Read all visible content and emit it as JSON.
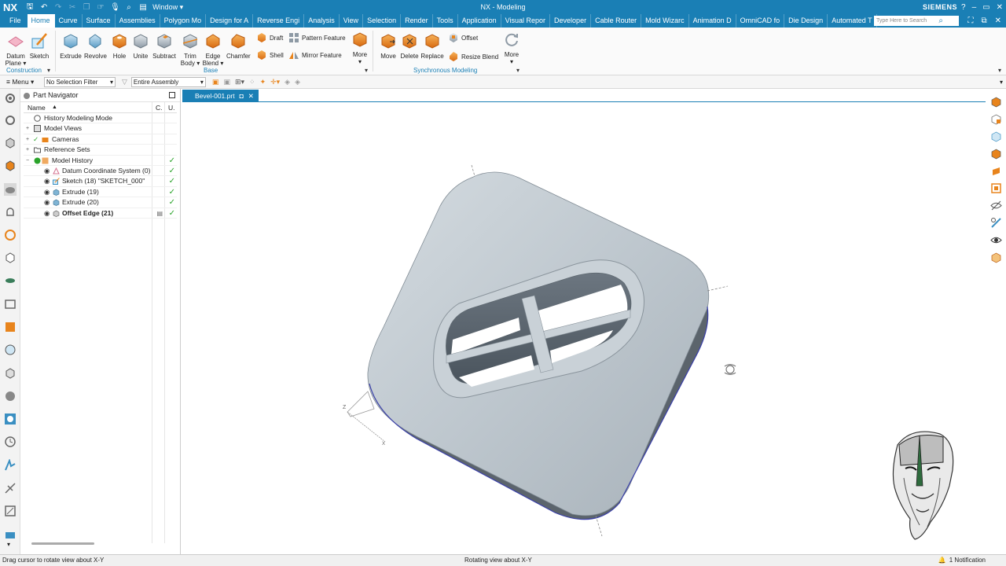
{
  "titlebar": {
    "logo": "NX",
    "window_menu": "Window ▾",
    "title": "NX - Modeling",
    "brand": "SIEMENS",
    "controls": [
      "?",
      "–",
      "▭",
      "✕"
    ]
  },
  "tabs": {
    "file": "File",
    "items": [
      "Home",
      "Curve",
      "Surface",
      "Assemblies",
      "Polygon Mo",
      "Design for A",
      "Reverse Engi",
      "Analysis",
      "View",
      "Selection",
      "Render",
      "Tools",
      "Application",
      "Visual Repor",
      "Developer",
      "Cable Router",
      "Mold Wizarc",
      "Animation D",
      "OmniCAD fo",
      "Die Design",
      "Automated T"
    ],
    "active": "Home",
    "search_placeholder": "Type Here to Search"
  },
  "ribbon": {
    "datum_plane": "Datum\nPlane ▾",
    "sketch": "Sketch",
    "extrude": "Extrude",
    "revolve": "Revolve",
    "hole": "Hole",
    "unite": "Unite",
    "subtract": "Subtract",
    "trim_body": "Trim\nBody ▾",
    "edge_blend": "Edge\nBlend ▾",
    "chamfer": "Chamfer",
    "draft": "Draft",
    "shell": "Shell",
    "pattern_feature": "Pattern Feature",
    "mirror_feature": "Mirror Feature",
    "more1": "More",
    "move": "Move",
    "delete": "Delete",
    "replace": "Replace",
    "offset": "Offset",
    "resize_blend": "Resize Blend",
    "more2": "More",
    "group_construction": "Construction",
    "group_base": "Base",
    "group_sync": "Synchronous Modeling"
  },
  "selection_bar": {
    "menu": "Menu ▾",
    "filter": "No Selection Filter",
    "scope": "Entire Assembly"
  },
  "navigator": {
    "title": "Part Navigator",
    "col_name": "Name",
    "col_c": "C.",
    "col_u": "U.",
    "rows": [
      {
        "label": "History Modeling Mode",
        "check": ""
      },
      {
        "label": "Model Views",
        "check": ""
      },
      {
        "label": "Cameras",
        "check": ""
      },
      {
        "label": "Reference Sets",
        "check": ""
      },
      {
        "label": "Model History",
        "check": "✓"
      },
      {
        "label": "Datum Coordinate System (0)",
        "check": "✓"
      },
      {
        "label": "Sketch (18) \"SKETCH_000\"",
        "check": "✓"
      },
      {
        "label": "Extrude (19)",
        "check": "✓"
      },
      {
        "label": "Extrude (20)",
        "check": "✓"
      },
      {
        "label": "Offset Edge (21)",
        "check": "✓"
      }
    ]
  },
  "graphics": {
    "tab": "Bevel-001.prt",
    "tab_pin": "◘",
    "tab_close": "✕"
  },
  "status": {
    "left": "Drag cursor to rotate view about X-Y",
    "middle": "Rotating view about X-Y",
    "notification": "1 Notification"
  },
  "colors": {
    "accent": "#1a7fb5",
    "part_gray": "#c4ccd2",
    "check_green": "#2aa32a",
    "icon_orange": "#e8841c"
  }
}
